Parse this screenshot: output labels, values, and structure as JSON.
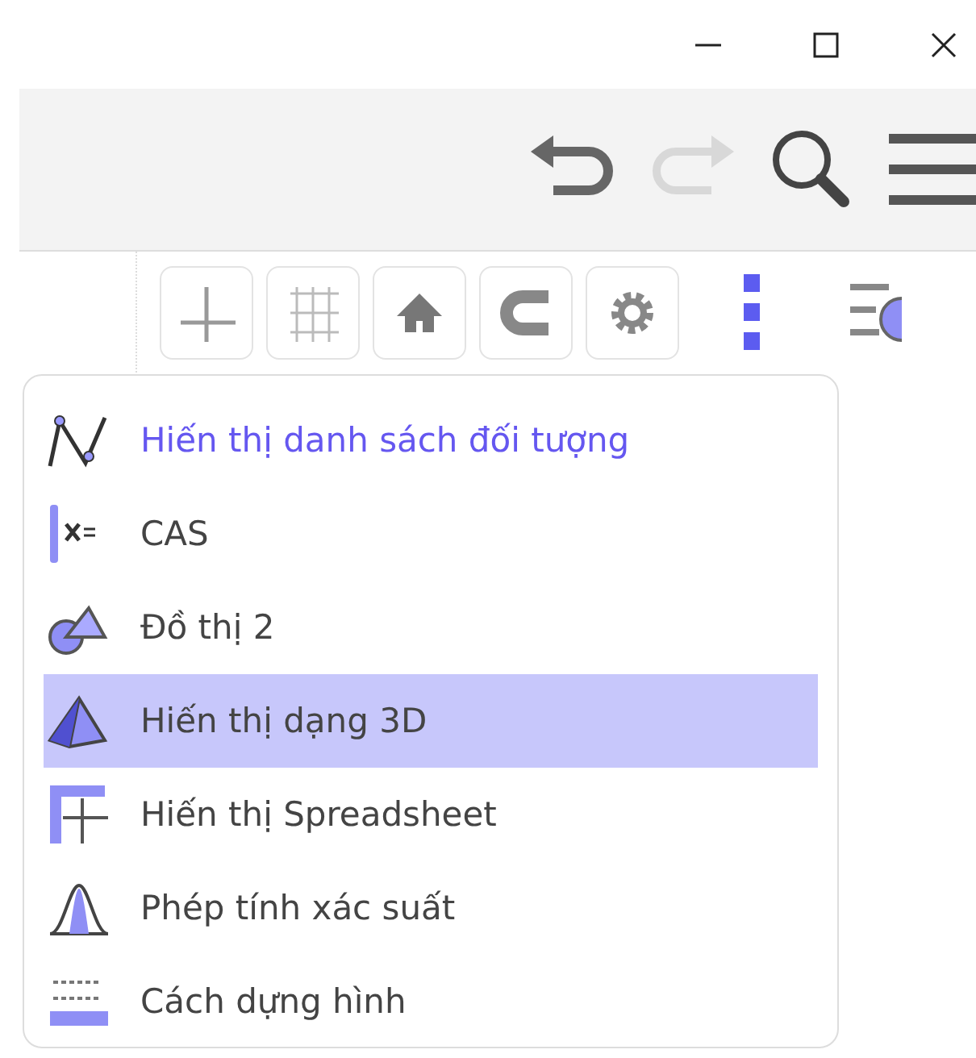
{
  "toolbar": {
    "buttons": [
      {
        "kind": "undo",
        "disabled": false
      },
      {
        "kind": "redo",
        "disabled": true
      },
      {
        "kind": "search",
        "disabled": false
      },
      {
        "kind": "menu",
        "disabled": false
      }
    ]
  },
  "style_bar": {
    "buttons": [
      {
        "kind": "axes"
      },
      {
        "kind": "grid"
      },
      {
        "kind": "home"
      },
      {
        "kind": "magnet"
      },
      {
        "kind": "gear"
      }
    ],
    "more_open": true
  },
  "view_menu": {
    "items": [
      {
        "kind": "algebra",
        "label": "Hiến thị danh sách đối tượng",
        "emphasized": true,
        "selected": false
      },
      {
        "kind": "cas",
        "label": "CAS",
        "emphasized": false,
        "selected": false
      },
      {
        "kind": "graphics2",
        "label": "Đồ thị 2",
        "emphasized": false,
        "selected": false
      },
      {
        "kind": "pyramid",
        "label": "Hiến thị dạng 3D",
        "emphasized": false,
        "selected": true
      },
      {
        "kind": "spreadsheet",
        "label": "Hiến thị Spreadsheet",
        "emphasized": false,
        "selected": false
      },
      {
        "kind": "probability",
        "label": "Phép tính xác suất",
        "emphasized": false,
        "selected": false
      },
      {
        "kind": "construction",
        "label": "Cách dựng hình",
        "emphasized": false,
        "selected": false
      }
    ]
  }
}
